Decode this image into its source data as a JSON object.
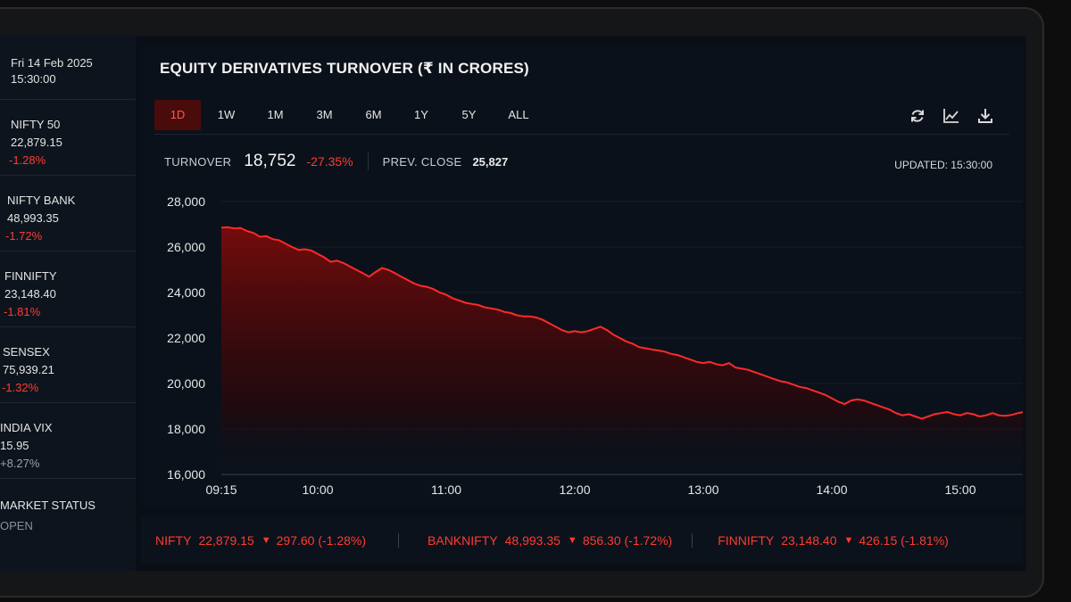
{
  "sidebar": {
    "date": "Fri 14 Feb 2025",
    "time": "15:30:00",
    "items": [
      {
        "name": "NIFTY 50",
        "value": "22,879.15",
        "change": "-1.28%",
        "dir": "down"
      },
      {
        "name": "NIFTY BANK",
        "value": "48,993.35",
        "change": "-1.72%",
        "dir": "down"
      },
      {
        "name": "FINNIFTY",
        "value": "23,148.40",
        "change": "-1.81%",
        "dir": "down"
      },
      {
        "name": "SENSEX",
        "value": "75,939.21",
        "change": "-1.32%",
        "dir": "down"
      },
      {
        "name": "INDIA VIX",
        "value": "15.95",
        "change": "+8.27%",
        "dir": "up"
      }
    ],
    "status_label": "MARKET STATUS",
    "status_value": "OPEN"
  },
  "panel": {
    "title": "EQUITY DERIVATIVES TURNOVER (₹ IN CRORES)",
    "ranges": [
      "1D",
      "1W",
      "1M",
      "3M",
      "6M",
      "1Y",
      "5Y",
      "ALL"
    ],
    "active_range": "1D",
    "tools": [
      "refresh-icon",
      "line-chart-icon",
      "download-icon"
    ],
    "turnover_label": "TURNOVER",
    "turnover_value": "18,752",
    "turnover_change": "-27.35%",
    "prev_close_label": "PREV. CLOSE",
    "prev_close_value": "25,827",
    "updated": "UPDATED: 15:30:00"
  },
  "colors": {
    "accent": "#ff3b30",
    "line": "#ff2a2a",
    "background": "#0a0f17"
  },
  "chart_data": {
    "type": "area",
    "ylim": [
      16000,
      28000
    ],
    "yticks": [
      "28,000",
      "26,000",
      "24,000",
      "22,000",
      "20,000",
      "18,000",
      "16,000"
    ],
    "ytick_values": [
      28000,
      26000,
      24000,
      22000,
      20000,
      18000,
      16000
    ],
    "xticks": [
      "09:15",
      "10:00",
      "11:00",
      "12:00",
      "13:00",
      "14:00",
      "15:00"
    ],
    "xtick_values": [
      0,
      45,
      105,
      165,
      225,
      285,
      345
    ],
    "x_max": 375,
    "x_unit": "minutes from 09:15",
    "points": [
      [
        0,
        26850
      ],
      [
        3,
        26870
      ],
      [
        6,
        26820
      ],
      [
        9,
        26840
      ],
      [
        12,
        26700
      ],
      [
        15,
        26620
      ],
      [
        18,
        26450
      ],
      [
        21,
        26480
      ],
      [
        24,
        26350
      ],
      [
        27,
        26300
      ],
      [
        30,
        26150
      ],
      [
        33,
        26000
      ],
      [
        36,
        25880
      ],
      [
        39,
        25900
      ],
      [
        42,
        25850
      ],
      [
        45,
        25700
      ],
      [
        48,
        25550
      ],
      [
        51,
        25350
      ],
      [
        54,
        25400
      ],
      [
        57,
        25300
      ],
      [
        60,
        25150
      ],
      [
        63,
        25000
      ],
      [
        66,
        24850
      ],
      [
        69,
        24700
      ],
      [
        72,
        24900
      ],
      [
        75,
        25080
      ],
      [
        78,
        25000
      ],
      [
        81,
        24850
      ],
      [
        84,
        24700
      ],
      [
        87,
        24550
      ],
      [
        90,
        24400
      ],
      [
        93,
        24300
      ],
      [
        96,
        24250
      ],
      [
        99,
        24150
      ],
      [
        102,
        24000
      ],
      [
        105,
        23900
      ],
      [
        108,
        23750
      ],
      [
        111,
        23650
      ],
      [
        114,
        23550
      ],
      [
        117,
        23500
      ],
      [
        120,
        23450
      ],
      [
        123,
        23350
      ],
      [
        126,
        23300
      ],
      [
        129,
        23250
      ],
      [
        132,
        23150
      ],
      [
        135,
        23100
      ],
      [
        138,
        23000
      ],
      [
        141,
        22950
      ],
      [
        144,
        22950
      ],
      [
        147,
        22900
      ],
      [
        150,
        22800
      ],
      [
        153,
        22650
      ],
      [
        156,
        22500
      ],
      [
        159,
        22350
      ],
      [
        162,
        22250
      ],
      [
        165,
        22300
      ],
      [
        168,
        22250
      ],
      [
        171,
        22300
      ],
      [
        174,
        22400
      ],
      [
        177,
        22500
      ],
      [
        180,
        22350
      ],
      [
        183,
        22150
      ],
      [
        186,
        22000
      ],
      [
        189,
        21850
      ],
      [
        192,
        21750
      ],
      [
        195,
        21600
      ],
      [
        198,
        21550
      ],
      [
        201,
        21500
      ],
      [
        204,
        21450
      ],
      [
        207,
        21400
      ],
      [
        210,
        21300
      ],
      [
        213,
        21250
      ],
      [
        216,
        21150
      ],
      [
        219,
        21050
      ],
      [
        222,
        20950
      ],
      [
        225,
        20900
      ],
      [
        228,
        20950
      ],
      [
        231,
        20850
      ],
      [
        234,
        20800
      ],
      [
        237,
        20900
      ],
      [
        240,
        20700
      ],
      [
        243,
        20650
      ],
      [
        246,
        20600
      ],
      [
        249,
        20500
      ],
      [
        252,
        20400
      ],
      [
        255,
        20300
      ],
      [
        258,
        20200
      ],
      [
        261,
        20100
      ],
      [
        264,
        20050
      ],
      [
        267,
        19950
      ],
      [
        270,
        19850
      ],
      [
        273,
        19800
      ],
      [
        276,
        19700
      ],
      [
        279,
        19600
      ],
      [
        282,
        19500
      ],
      [
        285,
        19350
      ],
      [
        288,
        19200
      ],
      [
        291,
        19100
      ],
      [
        294,
        19250
      ],
      [
        297,
        19300
      ],
      [
        300,
        19250
      ],
      [
        303,
        19150
      ],
      [
        306,
        19050
      ],
      [
        309,
        18950
      ],
      [
        312,
        18850
      ],
      [
        315,
        18700
      ],
      [
        318,
        18600
      ],
      [
        321,
        18650
      ],
      [
        324,
        18550
      ],
      [
        327,
        18450
      ],
      [
        330,
        18550
      ],
      [
        333,
        18650
      ],
      [
        336,
        18700
      ],
      [
        339,
        18750
      ],
      [
        342,
        18650
      ],
      [
        345,
        18600
      ],
      [
        348,
        18700
      ],
      [
        351,
        18650
      ],
      [
        354,
        18550
      ],
      [
        357,
        18600
      ],
      [
        360,
        18700
      ],
      [
        363,
        18600
      ],
      [
        366,
        18580
      ],
      [
        369,
        18620
      ],
      [
        372,
        18700
      ],
      [
        375,
        18752
      ]
    ]
  },
  "ticker": [
    {
      "symbol": "NIFTY",
      "value": "22,879.15",
      "change": "297.60 (-1.28%)"
    },
    {
      "symbol": "BANKNIFTY",
      "value": "48,993.35",
      "change": "856.30 (-1.72%)"
    },
    {
      "symbol": "FINNIFTY",
      "value": "23,148.40",
      "change": "426.15 (-1.81%)"
    }
  ]
}
